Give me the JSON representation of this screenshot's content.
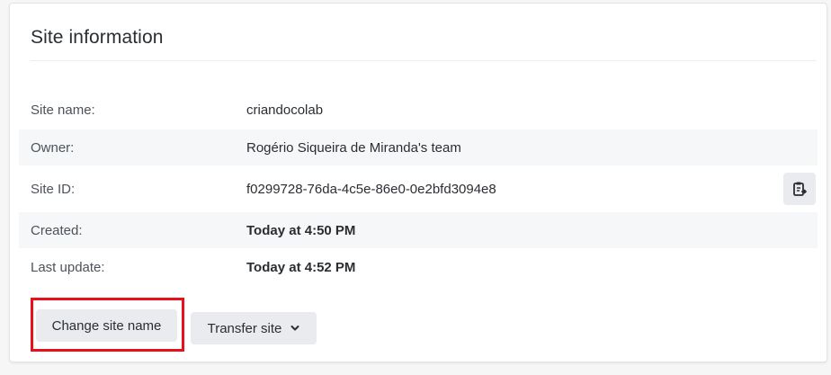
{
  "card": {
    "title": "Site information"
  },
  "info_rows": [
    {
      "label": "Site name:",
      "value": "criandocolab"
    },
    {
      "label": "Owner:",
      "value": "Rogério Siqueira de Miranda's team"
    },
    {
      "label": "Site ID:",
      "value": "f0299728-76da-4c5e-86e0-0e2bfd3094e8",
      "copy_icon": "clipboard-copy-icon"
    },
    {
      "label": "Created:",
      "value": "Today at 4:50 PM"
    },
    {
      "label": "Last update:",
      "value": "Today at 4:52 PM"
    }
  ],
  "actions": {
    "change_site_name_label": "Change site name",
    "transfer_site_label": "Transfer site",
    "transfer_site_icon": "chevron-down-icon"
  },
  "colors": {
    "highlight_border": "#e8101b",
    "button_bg": "#e9ebee",
    "alt_row_bg": "#f6f7f8"
  }
}
